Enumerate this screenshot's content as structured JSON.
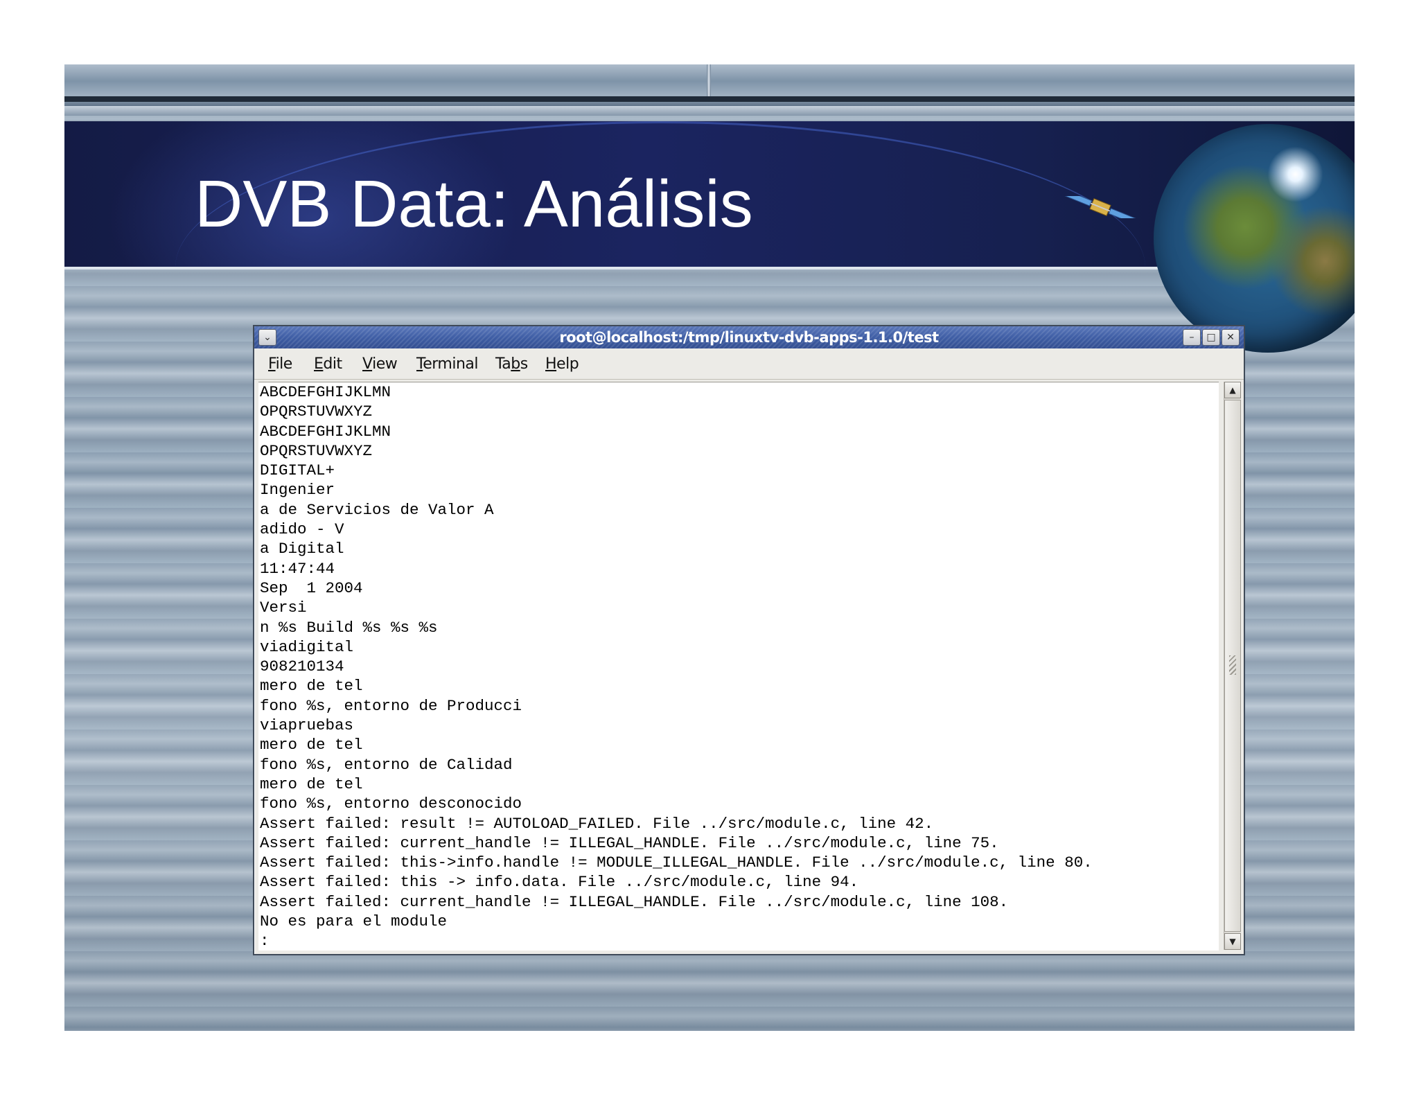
{
  "slide": {
    "title": "DVB Data: Análisis"
  },
  "window": {
    "title": "root@localhost:/tmp/linuxtv-dvb-apps-1.1.0/test",
    "menu": [
      {
        "label": "File",
        "accel": "F",
        "rest": "ile"
      },
      {
        "label": "Edit",
        "accel": "E",
        "rest": "dit"
      },
      {
        "label": "View",
        "accel": "V",
        "rest": "iew"
      },
      {
        "label": "Terminal",
        "accel": "T",
        "rest": "erminal"
      },
      {
        "label": "Tabs",
        "pre": "Ta",
        "accel": "b",
        "rest": "s"
      },
      {
        "label": "Help",
        "accel": "H",
        "rest": "elp"
      }
    ]
  },
  "terminal": {
    "lines": [
      "ABCDEFGHIJKLMN",
      "OPQRSTUVWXYZ",
      "ABCDEFGHIJKLMN",
      "OPQRSTUVWXYZ",
      "DIGITAL+",
      "Ingenier",
      "a de Servicios de Valor A",
      "adido - V",
      "a Digital",
      "11:47:44",
      "Sep  1 2004",
      "Versi",
      "n %s Build %s %s %s",
      "viadigital",
      "908210134",
      "mero de tel",
      "fono %s, entorno de Producci",
      "viapruebas",
      "mero de tel",
      "fono %s, entorno de Calidad",
      "mero de tel",
      "fono %s, entorno desconocido",
      "Assert failed: result != AUTOLOAD_FAILED. File ../src/module.c, line 42.",
      "Assert failed: current_handle != ILLEGAL_HANDLE. File ../src/module.c, line 75.",
      "Assert failed: this->info.handle != MODULE_ILLEGAL_HANDLE. File ../src/module.c, line 80.",
      "Assert failed: this -> info.data. File ../src/module.c, line 94.",
      "Assert failed: current_handle != ILLEGAL_HANDLE. File ../src/module.c, line 108.",
      "No es para el module",
      ":"
    ]
  },
  "icons": {
    "window_menu": "chevron-down-icon",
    "minimize": "minimize-icon",
    "maximize": "maximize-icon",
    "close": "close-icon",
    "scroll_up": "arrow-up-icon",
    "scroll_down": "arrow-down-icon"
  }
}
